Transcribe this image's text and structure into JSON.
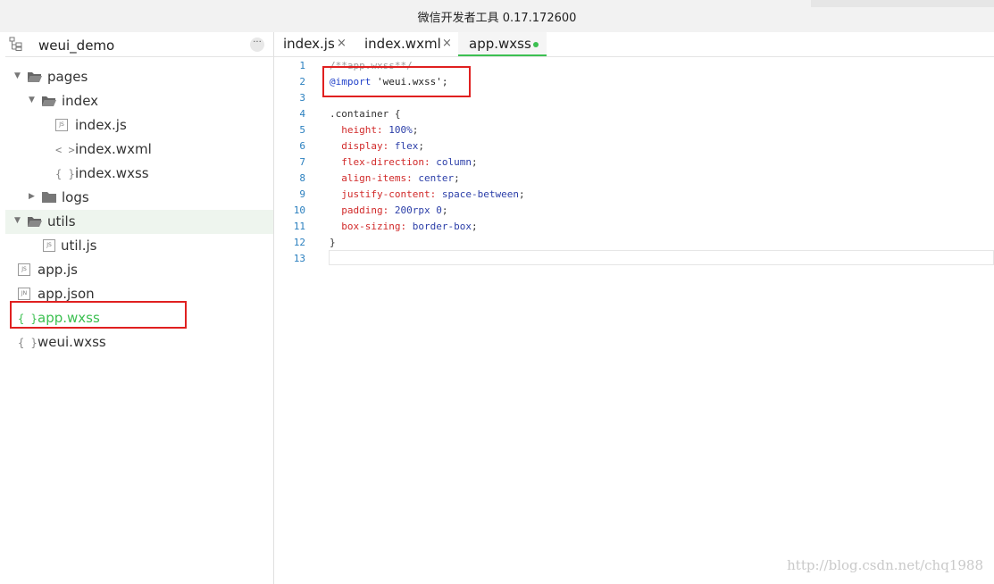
{
  "window": {
    "title": "微信开发者工具 0.17.172600"
  },
  "sidebar": {
    "project_name": "weui_demo",
    "more_label": "···",
    "tree": [
      {
        "label": "pages",
        "type": "folder",
        "expanded": true
      },
      {
        "label": "index",
        "type": "folder",
        "expanded": true
      },
      {
        "label": "index.js",
        "type": "file",
        "badge": "JS"
      },
      {
        "label": "index.wxml",
        "type": "file",
        "badge": "< >"
      },
      {
        "label": "index.wxss",
        "type": "file",
        "badge": "{ }"
      },
      {
        "label": "logs",
        "type": "folder",
        "expanded": false
      },
      {
        "label": "utils",
        "type": "folder",
        "expanded": true,
        "selected": true
      },
      {
        "label": "util.js",
        "type": "file",
        "badge": "JS"
      },
      {
        "label": "app.js",
        "type": "file",
        "badge": "JS"
      },
      {
        "label": "app.json",
        "type": "file",
        "badge": "JN"
      },
      {
        "label": "app.wxss",
        "type": "file",
        "badge": "{ }",
        "active": true
      },
      {
        "label": "weui.wxss",
        "type": "file",
        "badge": "{ }"
      }
    ]
  },
  "tabs": [
    {
      "label": "index.js",
      "close": "×"
    },
    {
      "label": "index.wxml",
      "close": "×"
    },
    {
      "label": "app.wxss",
      "active": true
    }
  ],
  "editor": {
    "lines": [
      {
        "n": "1",
        "parts": [
          {
            "t": "/**app.wxss**/",
            "c": "c-comment"
          }
        ]
      },
      {
        "n": "2",
        "parts": [
          {
            "t": "@import",
            "c": "c-at"
          },
          {
            "t": " 'weui.wxss';",
            "c": "c-str"
          }
        ]
      },
      {
        "n": "3",
        "parts": []
      },
      {
        "n": "4",
        "parts": [
          {
            "t": ".container {",
            "c": "c-sel"
          }
        ]
      },
      {
        "n": "5",
        "parts": [
          {
            "t": "  height: ",
            "c": "c-prop"
          },
          {
            "t": "100%",
            "c": "c-val"
          },
          {
            "t": ";",
            "c": "c-sel"
          }
        ]
      },
      {
        "n": "6",
        "parts": [
          {
            "t": "  display: ",
            "c": "c-prop"
          },
          {
            "t": "flex",
            "c": "c-val"
          },
          {
            "t": ";",
            "c": "c-sel"
          }
        ]
      },
      {
        "n": "7",
        "parts": [
          {
            "t": "  flex-direction: ",
            "c": "c-prop"
          },
          {
            "t": "column",
            "c": "c-val"
          },
          {
            "t": ";",
            "c": "c-sel"
          }
        ]
      },
      {
        "n": "8",
        "parts": [
          {
            "t": "  align-items: ",
            "c": "c-prop"
          },
          {
            "t": "center",
            "c": "c-val"
          },
          {
            "t": ";",
            "c": "c-sel"
          }
        ]
      },
      {
        "n": "9",
        "parts": [
          {
            "t": "  justify-content: ",
            "c": "c-prop"
          },
          {
            "t": "space-between",
            "c": "c-val"
          },
          {
            "t": ";",
            "c": "c-sel"
          }
        ]
      },
      {
        "n": "10",
        "parts": [
          {
            "t": "  padding: ",
            "c": "c-prop"
          },
          {
            "t": "200rpx 0",
            "c": "c-val"
          },
          {
            "t": ";",
            "c": "c-sel"
          }
        ]
      },
      {
        "n": "11",
        "parts": [
          {
            "t": "  box-sizing: ",
            "c": "c-prop"
          },
          {
            "t": "border-box",
            "c": "c-val"
          },
          {
            "t": ";",
            "c": "c-sel"
          }
        ]
      },
      {
        "n": "12",
        "parts": [
          {
            "t": "}",
            "c": "c-sel"
          }
        ]
      },
      {
        "n": "13",
        "parts": []
      }
    ]
  },
  "watermark": "http://blog.csdn.net/chq1988",
  "colors": {
    "accent": "#3cc051",
    "highlight_box": "#e02020"
  }
}
